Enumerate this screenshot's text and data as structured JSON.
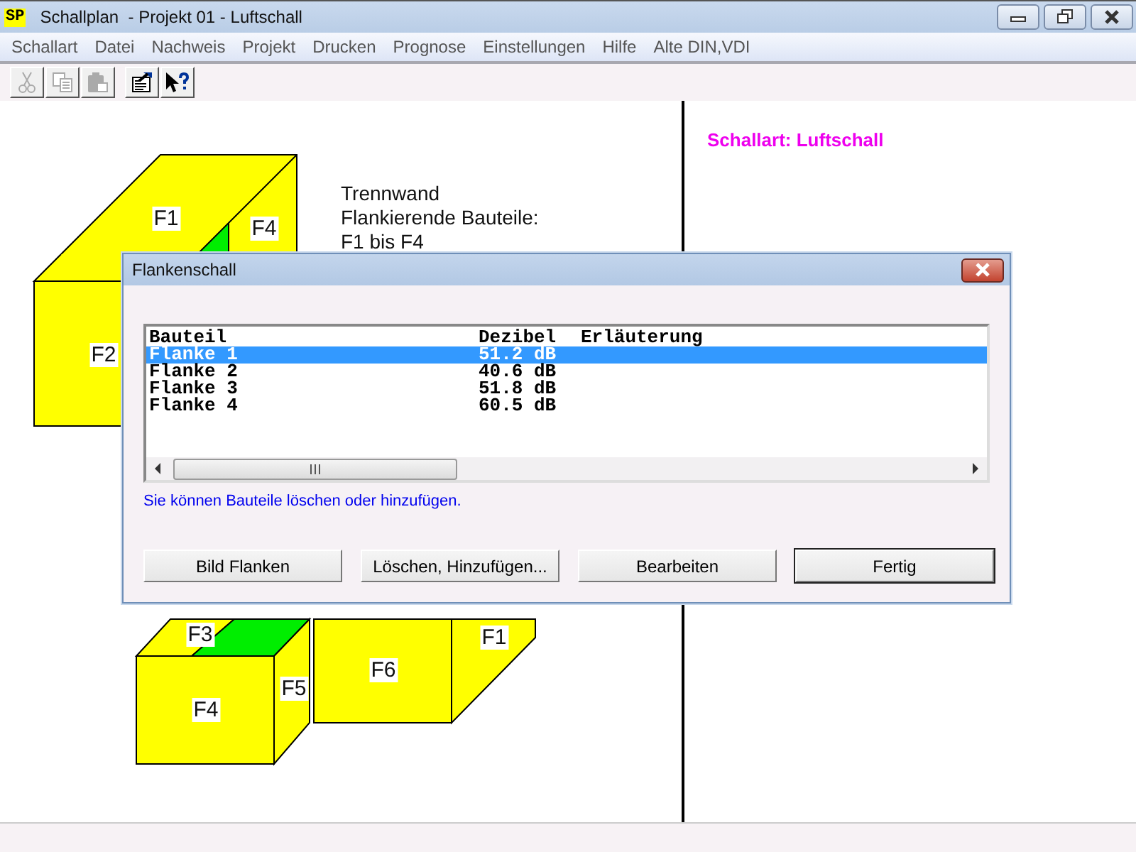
{
  "window": {
    "app_icon_text": "SP",
    "title": "Schallplan  - Projekt 01 - Luftschall"
  },
  "menu": [
    "Schallart",
    "Datei",
    "Nachweis",
    "Projekt",
    "Drucken",
    "Prognose",
    "Einstellungen",
    "Hilfe",
    "Alte DIN,VDI"
  ],
  "toolbar": [
    {
      "kind": "cut",
      "disabled": true
    },
    {
      "kind": "copy",
      "disabled": true
    },
    {
      "kind": "paste",
      "disabled": true
    },
    {
      "kind": "properties",
      "disabled": false
    },
    {
      "kind": "help",
      "disabled": false
    }
  ],
  "canvas": {
    "description_lines": [
      "Trennwand",
      "Flankierende Bauteile:",
      "F1 bis F4"
    ],
    "top_labels": [
      "F1",
      "F4",
      "F2"
    ],
    "bottom_labels": [
      "F3",
      "F1",
      "F4",
      "F5",
      "F6"
    ]
  },
  "side_panel": {
    "heading": "Schallart: Luftschall"
  },
  "dialog": {
    "title": "Flankenschall",
    "columns": [
      "Bauteil",
      "Dezibel",
      "Erläuterung"
    ],
    "rows": [
      {
        "cells": [
          "Flanke 1",
          "51.2 dB"
        ],
        "selected": true
      },
      {
        "cells": [
          "Flanke 2",
          "40.6 dB"
        ],
        "selected": false
      },
      {
        "cells": [
          "Flanke 3",
          "51.8 dB"
        ],
        "selected": false
      },
      {
        "cells": [
          "Flanke 4",
          "60.5 dB"
        ],
        "selected": false
      }
    ],
    "hint": "Sie können Bauteile löschen oder hinzufügen.",
    "buttons": [
      {
        "label": "Bild Flanken",
        "default": false
      },
      {
        "label": "Löschen, Hinzufügen...",
        "default": false
      },
      {
        "label": "Bearbeiten",
        "default": false
      },
      {
        "label": "Fertig",
        "default": true
      }
    ]
  }
}
